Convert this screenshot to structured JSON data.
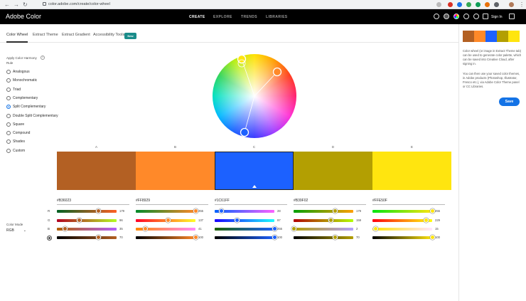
{
  "browser": {
    "url": "color.adobe.com/create/color-wheel"
  },
  "app": {
    "logo": "Adobe Color",
    "nav": [
      "CREATE",
      "EXPLORE",
      "TRENDS",
      "LIBRARIES"
    ],
    "active_nav": "CREATE",
    "sign_in": "Sign In"
  },
  "tabs": [
    "Color Wheel",
    "Extract Theme",
    "Extract Gradient",
    "Accessibility Tools"
  ],
  "new_badge": "New",
  "harmony": {
    "title": "Apply Color Harmony Rule",
    "info": "?",
    "rules": [
      "Analogous",
      "Monochromatic",
      "Triad",
      "Complementary",
      "Split Complementary",
      "Double Split Complementary",
      "Square",
      "Compound",
      "Shades",
      "Custom"
    ],
    "selected": "Split Complementary"
  },
  "swatches": [
    {
      "letter": "A",
      "hex": "#B36023",
      "color": "#B36023",
      "values": [
        "179",
        "96",
        "35"
      ],
      "brightness": "70"
    },
    {
      "letter": "B",
      "hex": "#FF8929",
      "color": "#FF8929",
      "values": [
        "255",
        "137",
        "41"
      ],
      "brightness": "100"
    },
    {
      "letter": "C",
      "hex": "#1C61FF",
      "color": "#1C61FF",
      "values": [
        "28",
        "97",
        "255"
      ],
      "brightness": "100"
    },
    {
      "letter": "D",
      "hex": "#B39F02",
      "color": "#B39F02",
      "values": [
        "179",
        "159",
        "2"
      ],
      "brightness": "70"
    },
    {
      "letter": "E",
      "hex": "#FFE50F",
      "color": "#FFE50F",
      "values": [
        "255",
        "229",
        "15"
      ],
      "brightness": "100"
    }
  ],
  "selected_swatch": 2,
  "channels": [
    "R",
    "G",
    "B"
  ],
  "color_mode": {
    "label": "Color Mode",
    "value": "RGB"
  },
  "side": {
    "text1": "Color wheel (or image in Extract Theme tab) can be used to generate color palette, which can be saved into Creative Cloud, after signing in.",
    "text2": "You can then use your saved color themes, in Adobe products (Photoshop, Illustrator, Fresco etc.), via Adobe Color Theme panel or CC Libraries.",
    "save": "Save"
  },
  "icons": {
    "back": "back-arrow-icon",
    "forward": "forward-arrow-icon",
    "reload": "reload-icon",
    "info": "info-icon",
    "brightness": "brightness-icon",
    "chevron": "chevron-down-icon"
  }
}
